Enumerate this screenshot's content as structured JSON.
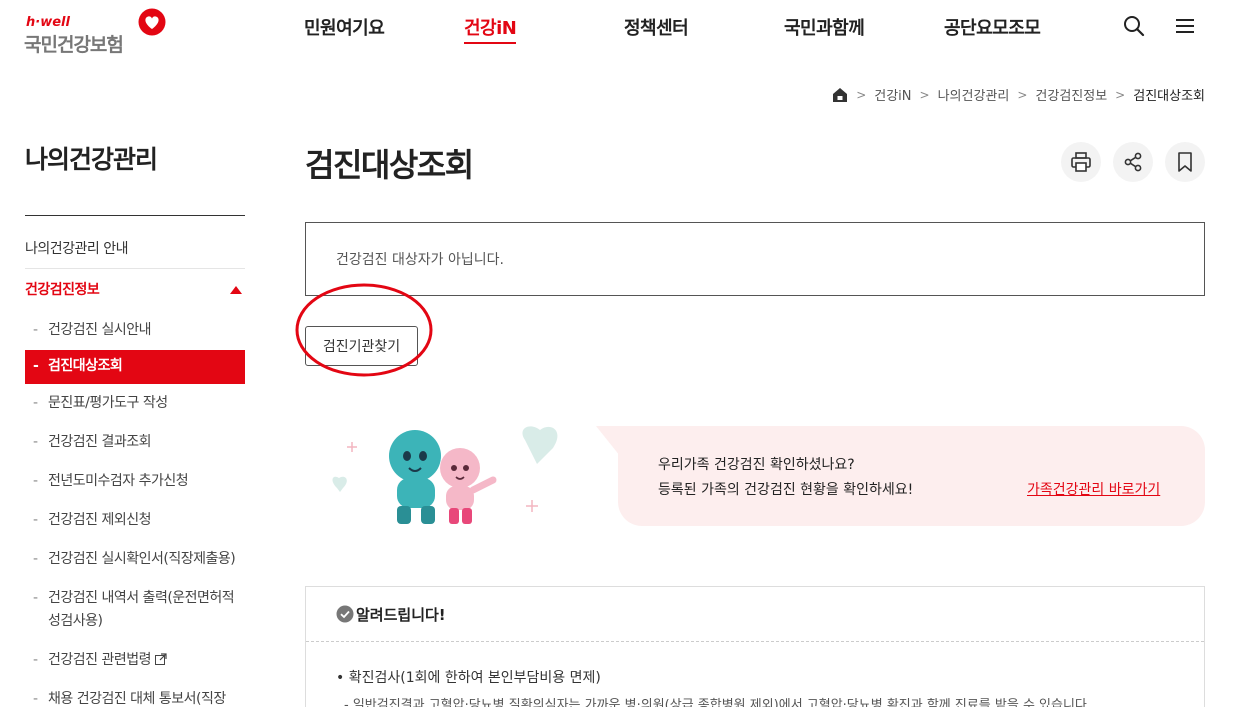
{
  "header": {
    "logo_top": "h·well",
    "logo_main": "국민건강보험",
    "nav": [
      "민원여기요",
      "건강iN",
      "정책센터",
      "국민과함께",
      "공단요모조모"
    ],
    "active_nav": "건강iN",
    "accent_color": "#e30613"
  },
  "breadcrumb": [
    "건강iN",
    "나의건강관리",
    "건강검진정보",
    "검진대상조회"
  ],
  "sidebar": {
    "title": "나의건강관리",
    "items": [
      {
        "label": "나의건강관리 안내"
      },
      {
        "label": "건강검진정보"
      }
    ],
    "sub_items": [
      {
        "label": "건강검진 실시안내"
      },
      {
        "label": "검진대상조회"
      },
      {
        "label": "문진표/평가도구 작성"
      },
      {
        "label": "건강검진 결과조회"
      },
      {
        "label": "전년도미수검자 추가신청"
      },
      {
        "label": "건강검진 제외신청"
      },
      {
        "label": "건강검진 실시확인서(직장제출용)"
      },
      {
        "label": "건강검진 내역서 출력(운전면허적성검사용)"
      },
      {
        "label": "건강검진 관련법령"
      },
      {
        "label": "채용 건강검진 대체 통보서(직장제출용)"
      }
    ]
  },
  "main": {
    "title": "검진대상조회",
    "notice": "건강검진 대상자가 아닙니다.",
    "find_button": "검진기관찾기",
    "banner": {
      "line1": "우리가족 건강검진 확인하셨나요?",
      "line2": "등록된 가족의 건강검진 현황을 확인하세요!",
      "link": "가족건강관리 바로가기"
    },
    "announce": {
      "title": "알려드립니다!",
      "bullet1": "확진검사(1회에 한하여 본인부담비용 면제)",
      "bullet2": "- 일반검진결과 고혈압·당뇨병 질환의심자는 가까운 병·의원(상급 종합병원 제외)에서 고혈압·당뇨병 확진과 함께 진료를 받을 수 있습니다"
    }
  }
}
